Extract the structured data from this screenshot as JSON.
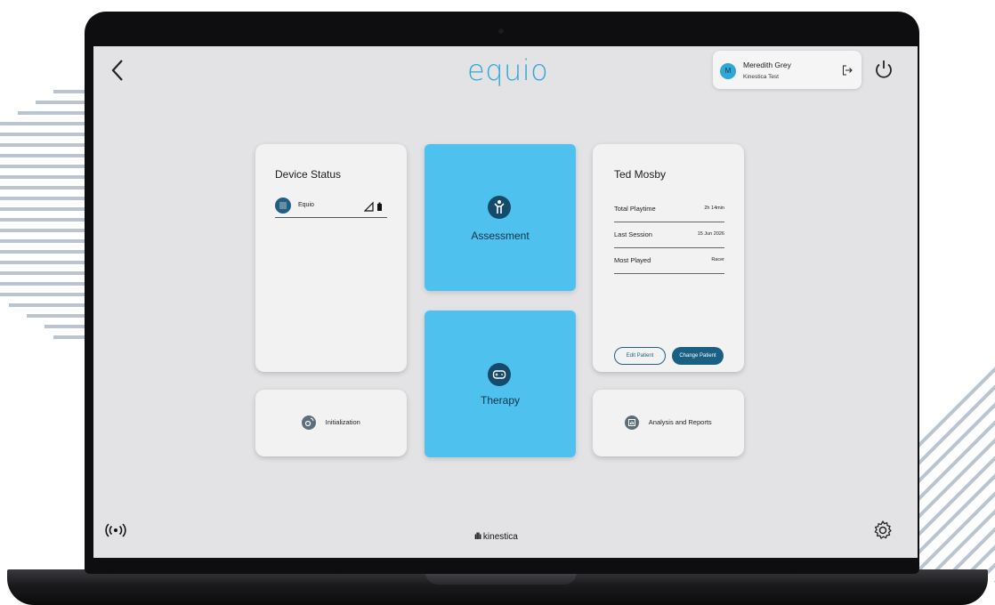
{
  "header": {
    "logo_text": "equio",
    "user": {
      "initial": "M",
      "name": "Meredith Grey",
      "organization": "Kinestica Test"
    }
  },
  "device_status": {
    "title": "Device Status",
    "devices": [
      {
        "name": "Equio"
      }
    ]
  },
  "tiles": {
    "assessment_label": "Assessment",
    "therapy_label": "Therapy"
  },
  "patient": {
    "name": "Ted Mosby",
    "stats": [
      {
        "label": "Total Playtime",
        "value": "2h 14min"
      },
      {
        "label": "Last Session",
        "value": "15 Jun 2026"
      },
      {
        "label": "Most Played",
        "value": "Racer"
      }
    ],
    "edit_label": "Edit Patient",
    "change_label": "Change Patient"
  },
  "actions": {
    "initialization_label": "Initialization",
    "reports_label": "Analysis and Reports"
  },
  "footer": {
    "brand": "kinestica"
  },
  "colors": {
    "accent": "#4fc1ef",
    "dark_teal": "#1a5f84",
    "logo": "#2fa8d8",
    "screen_bg": "#e3e3e5"
  },
  "icons": [
    "back-arrow-icon",
    "logout-icon",
    "power-icon",
    "person-icon",
    "gamepad-icon",
    "gear-sync-icon",
    "report-icon",
    "wireless-icon",
    "settings-gear-icon",
    "signal-icon",
    "battery-icon"
  ]
}
